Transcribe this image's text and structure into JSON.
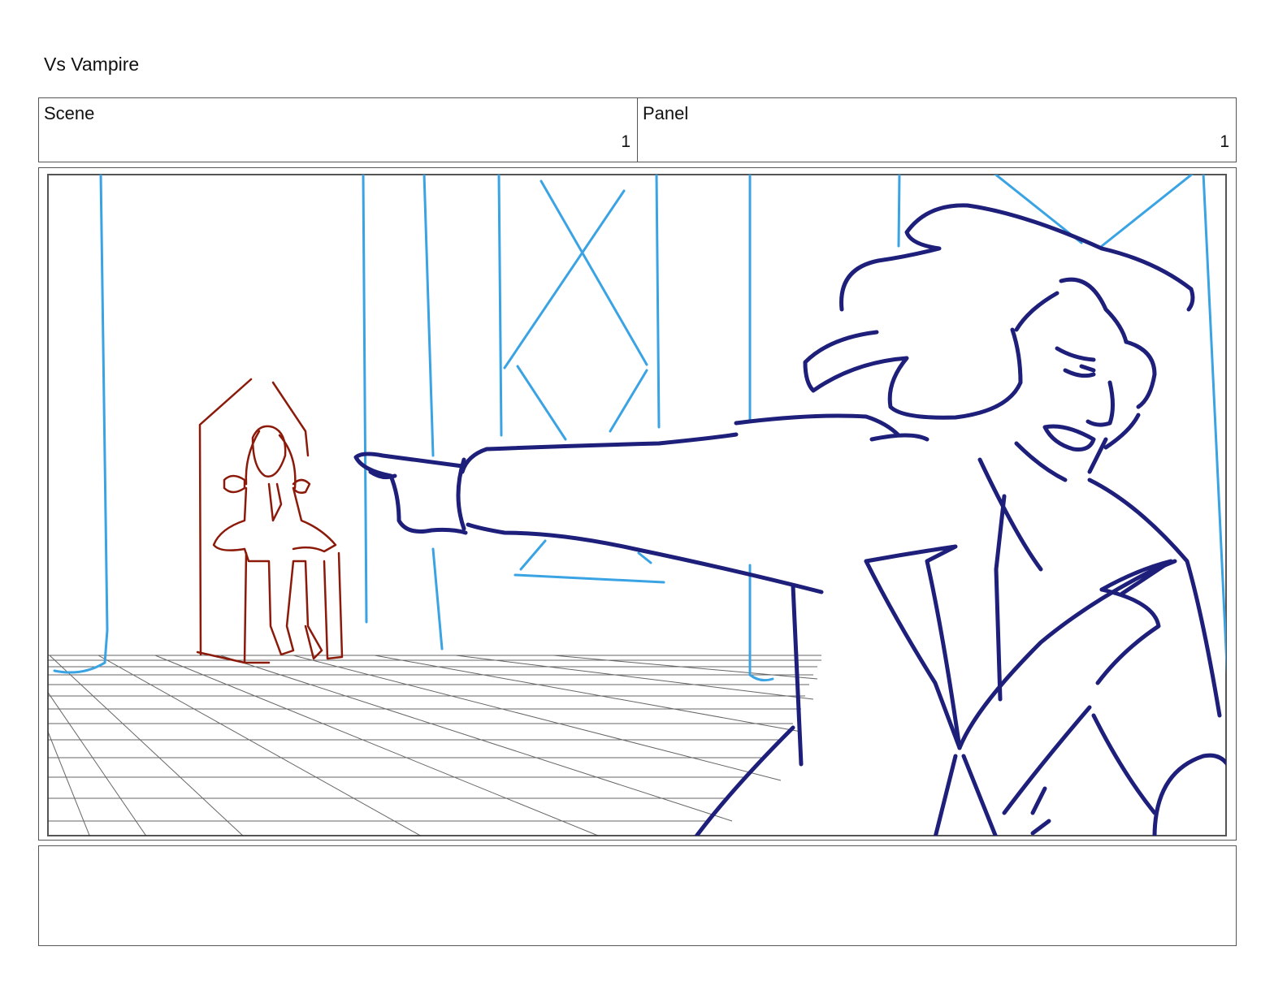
{
  "document": {
    "title": "Vs Vampire"
  },
  "header": {
    "scene": {
      "label": "Scene",
      "value": "1"
    },
    "panel": {
      "label": "Panel",
      "value": "1"
    }
  },
  "drawing": {
    "layers": [
      {
        "name": "background-columns-and-floor",
        "color": "#3aa3e3"
      },
      {
        "name": "vampire-on-throne",
        "color": "#8b1a0a"
      },
      {
        "name": "hero-pointing",
        "color": "#1d1f7a"
      }
    ]
  },
  "notes": {
    "text": ""
  }
}
